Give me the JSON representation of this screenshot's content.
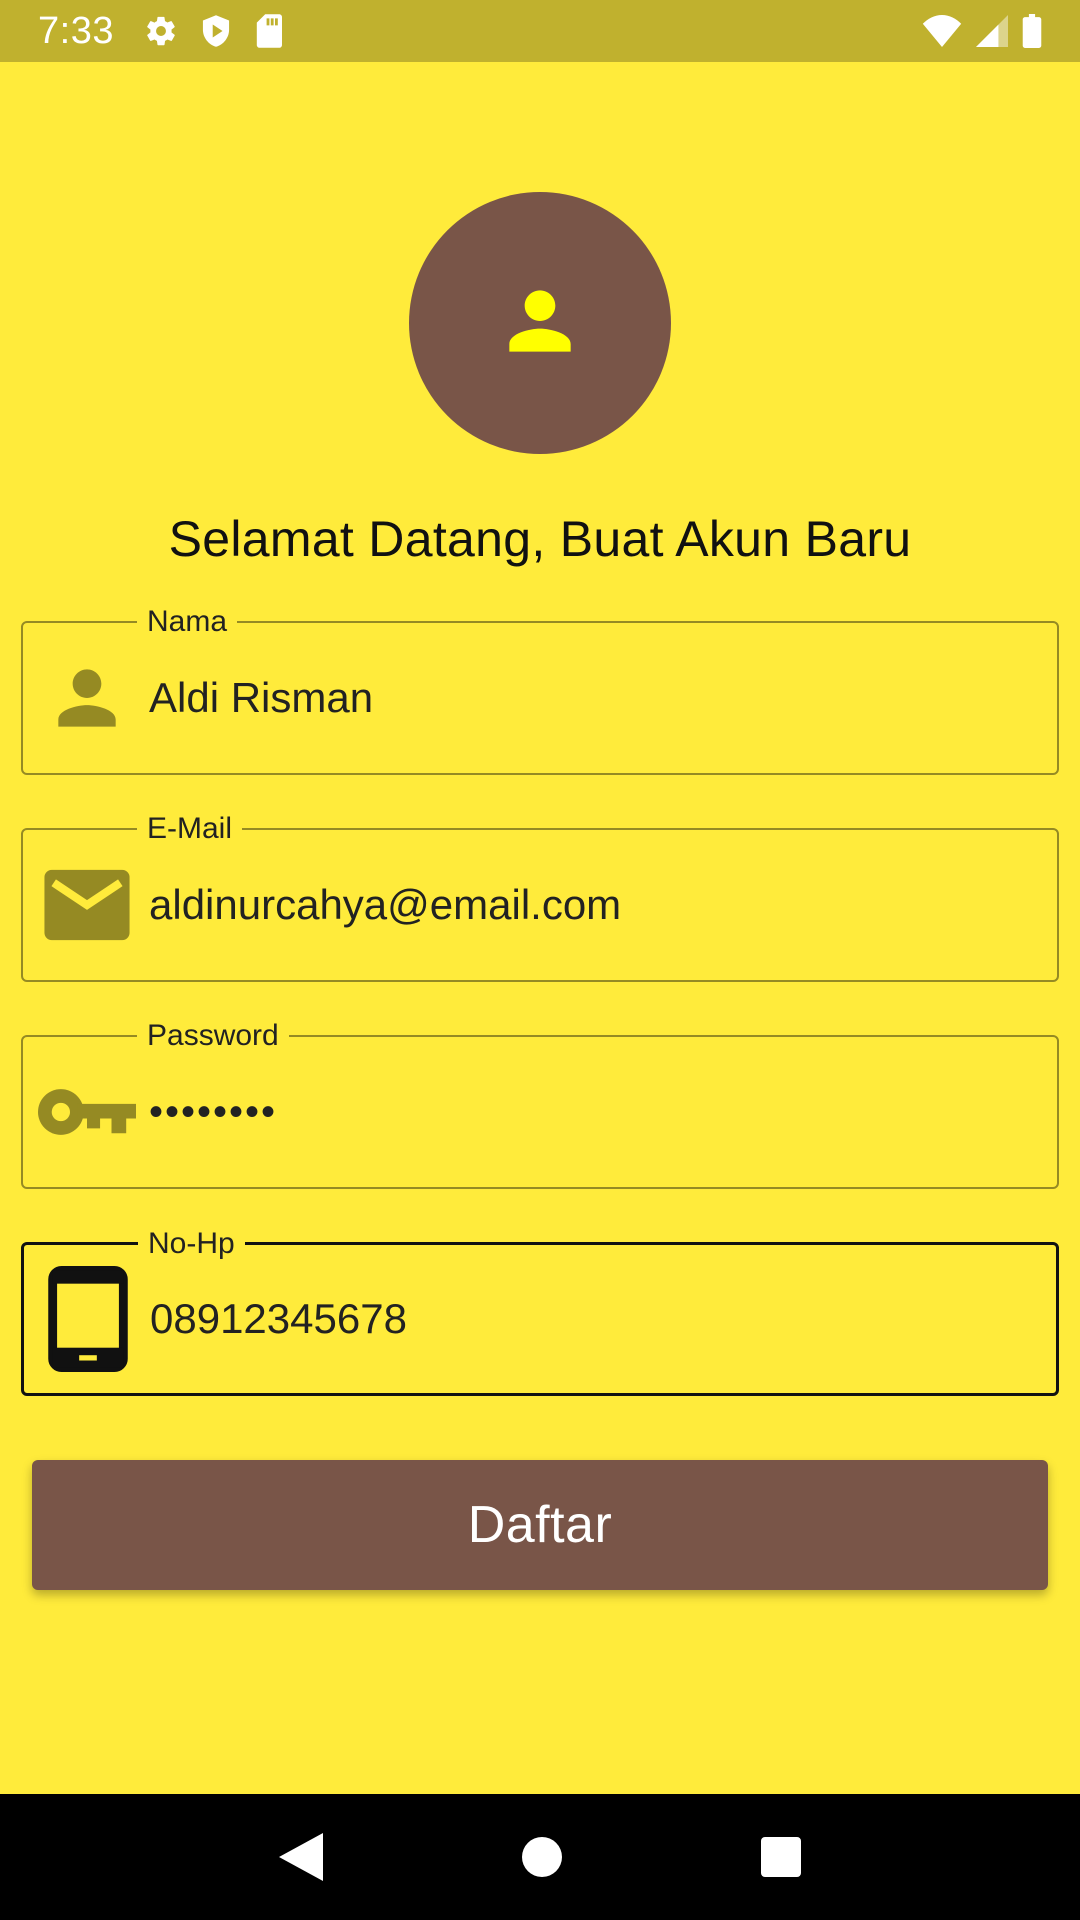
{
  "status_bar": {
    "time": "7:33",
    "left_icons": [
      "gear-icon",
      "shield-play-icon",
      "sd-card-icon"
    ],
    "right_icons": [
      "wifi-icon",
      "cellular-signal-icon",
      "battery-icon"
    ],
    "background": "#C0B12E"
  },
  "avatar": {
    "icon": "person-icon",
    "background": "#795548",
    "icon_color": "#FFFF00"
  },
  "headline": "Selamat Datang, Buat Akun Baru",
  "form": {
    "fields": [
      {
        "label": "Nama",
        "value": "Aldi Risman",
        "icon": "person-icon"
      },
      {
        "label": "E-Mail",
        "value": "aldinurcahya@email.com",
        "icon": "email-icon"
      },
      {
        "label": "Password",
        "value": "••••••••",
        "icon": "key-icon"
      },
      {
        "label": "No-Hp",
        "value": "08912345678",
        "icon": "tablet-icon",
        "focused": true
      }
    ],
    "submit_label": "Daftar"
  },
  "nav_bar": {
    "items": [
      "back-icon",
      "home-icon",
      "recents-icon"
    ]
  },
  "colors": {
    "background": "#FFEB3B",
    "accent_brown": "#795548",
    "icon_olive": "#958A23",
    "focused_border": "#111111"
  }
}
